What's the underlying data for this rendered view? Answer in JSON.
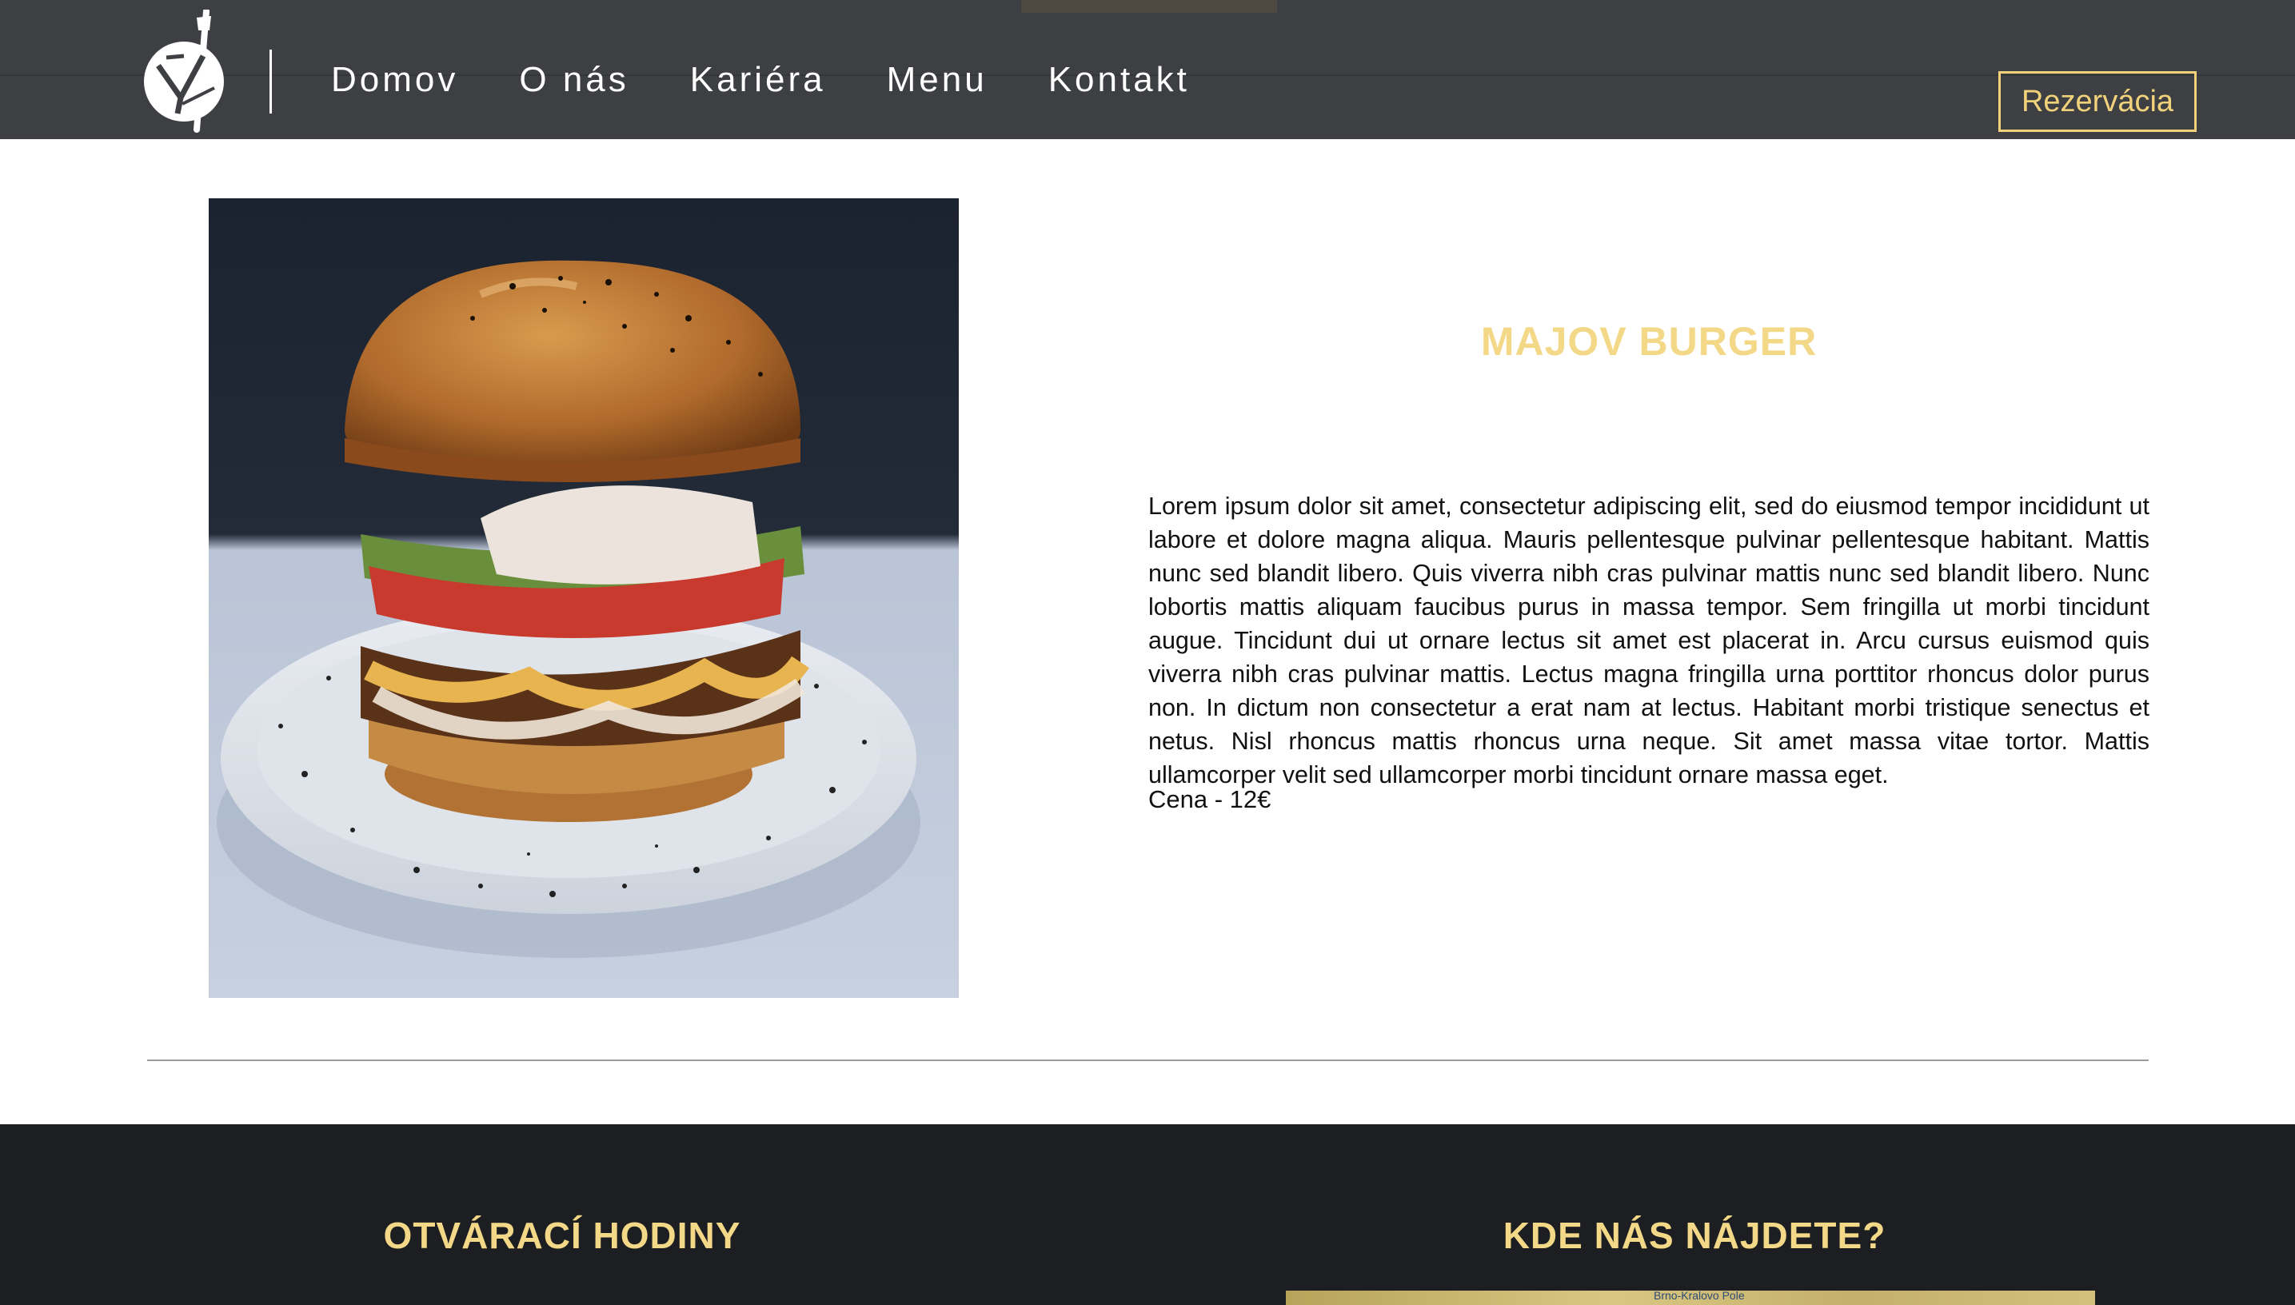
{
  "header": {
    "nav": [
      {
        "label": "Domov"
      },
      {
        "label": "O nás"
      },
      {
        "label": "Kariéra"
      },
      {
        "label": "Menu"
      },
      {
        "label": "Kontakt"
      }
    ],
    "reserve_label": "Rezervácia"
  },
  "product": {
    "image_icon": "burger-photo",
    "title": "MAJOV BURGER",
    "description": "Lorem ipsum dolor sit amet, consectetur adipiscing elit, sed do eiusmod tempor incididunt ut labore et dolore magna aliqua. Mauris pellentesque pulvinar pellentesque habitant. Mattis nunc sed blandit libero. Quis viverra nibh cras pulvinar mattis nunc sed blandit libero. Nunc lobortis mattis aliquam faucibus purus in massa tempor. Sem fringilla ut morbi tincidunt augue. Tincidunt dui ut ornare lectus sit amet est placerat in. Arcu cursus euismod quis viverra nibh cras pulvinar mattis. Lectus magna fringilla urna porttitor rhoncus dolor purus non. In dictum non consectetur a erat nam at lectus. Habitant morbi tristique senectus et netus. Nisl rhoncus mattis rhoncus urna neque. Sit amet massa vitae tortor. Mattis ullamcorper velit sed ullamcorper morbi tincidunt ornare massa eget.",
    "price": "Cena - 12€"
  },
  "footer": {
    "hours_title": "OTVÁRACÍ HODINY",
    "where_title": "KDE NÁS NÁJDETE?",
    "map_label": "Brno-Kralovo Pole"
  },
  "colors": {
    "header_bg": "#3e3f43",
    "accent": "#f1d27a",
    "footer_bg": "#1d1e21"
  }
}
